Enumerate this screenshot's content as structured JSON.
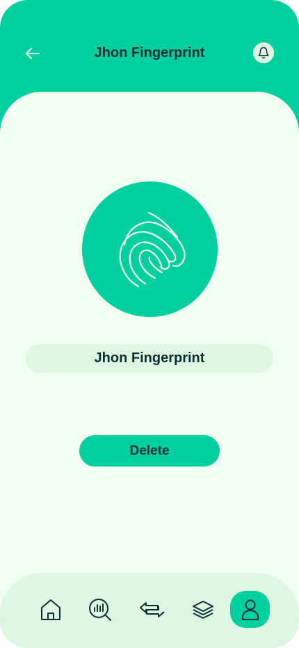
{
  "header": {
    "title": "Jhon Fingerprint",
    "back_icon": "arrow-left-icon",
    "notification_icon": "bell-icon"
  },
  "fingerprint": {
    "icon": "fingerprint-icon",
    "name": "Jhon Fingerprint"
  },
  "actions": {
    "delete_label": "Delete"
  },
  "bottom_nav": {
    "items": [
      {
        "icon": "home-icon",
        "active": false
      },
      {
        "icon": "analysis-icon",
        "active": false
      },
      {
        "icon": "transactions-icon",
        "active": false
      },
      {
        "icon": "categories-icon",
        "active": false
      },
      {
        "icon": "profile-icon",
        "active": true
      }
    ]
  },
  "colors": {
    "primary": "#00D09E",
    "background": "#F1FFF3",
    "light_green": "#DFF7E2",
    "dark_text": "#093030"
  }
}
